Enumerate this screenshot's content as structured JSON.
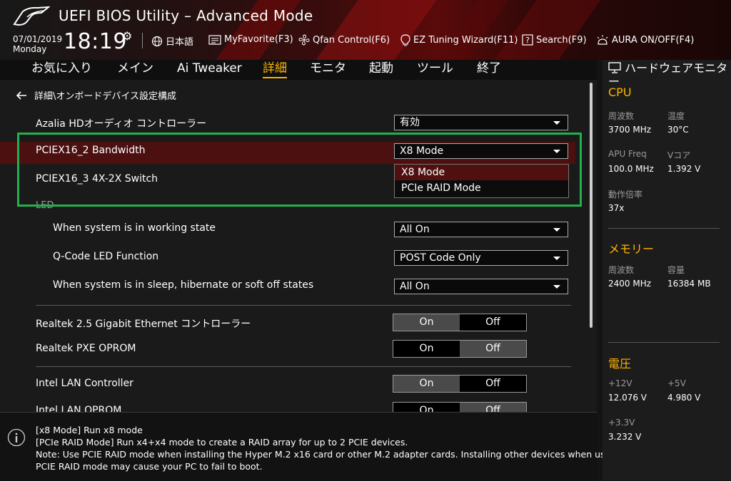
{
  "header": {
    "title": "UEFI BIOS Utility – Advanced Mode",
    "date": "07/01/2019",
    "day": "Monday",
    "time": "18:19",
    "items": [
      {
        "label": "日本語",
        "icon": "globe-icon"
      },
      {
        "label": "MyFavorite(F3)",
        "icon": "favorite-icon"
      },
      {
        "label": "Qfan Control(F6)",
        "icon": "fan-icon"
      },
      {
        "label": "EZ Tuning Wizard(F11)",
        "icon": "lightbulb-icon"
      },
      {
        "label": "Search(F9)",
        "icon": "search-icon"
      },
      {
        "label": "AURA ON/OFF(F4)",
        "icon": "aura-icon"
      }
    ]
  },
  "nav": {
    "tabs": [
      "お気に入り",
      "メイン",
      "Ai Tweaker",
      "詳細",
      "モニタ",
      "起動",
      "ツール",
      "終了"
    ],
    "active": "詳細"
  },
  "breadcrumb": "詳細\\オンボードデバイス設定構成",
  "settings": {
    "azalia": {
      "label": "Azalia HDオーディオ コントローラー",
      "value": "有効"
    },
    "pciex16_2": {
      "label": "PCIEX16_2 Bandwidth",
      "value": "X8 Mode",
      "options": [
        "X8 Mode",
        "PCIe RAID Mode"
      ]
    },
    "pciex16_3": {
      "label": "PCIEX16_3 4X-2X Switch"
    },
    "led_group": "LED",
    "led_working": {
      "label": "When system is in working state",
      "value": "All On"
    },
    "qcode": {
      "label": "Q-Code LED Function",
      "value": "POST Code Only"
    },
    "led_sleep": {
      "label": "When system is in sleep, hibernate or soft off states",
      "value": "All On"
    },
    "realtek_eth": {
      "label": "Realtek 2.5 Gigabit Ethernet コントローラー",
      "on": "On",
      "off": "Off",
      "state": "On"
    },
    "realtek_pxe": {
      "label": "Realtek PXE OPROM",
      "on": "On",
      "off": "Off",
      "state": "Off"
    },
    "intel_lan": {
      "label": "Intel LAN Controller",
      "on": "On",
      "off": "Off",
      "state": "On"
    },
    "intel_lan_oprom": {
      "label": "Intel LAN OPROM",
      "on": "On",
      "off": "Off",
      "state": "Off"
    }
  },
  "help": {
    "lines": [
      "[x8 Mode] Run x8 mode",
      "[PCIe RAID Mode] Run x4+x4 mode to create a RAID array for up to 2 PCIE devices.",
      "Note: Use PCIE RAID mode when installing the Hyper M.2 x16 card or other M.2 adapter cards. Installing other devices when using",
      "PCIE RAID mode may cause your PC to fail to boot."
    ]
  },
  "hw": {
    "title": "ハードウェアモニター",
    "cpu": {
      "title": "CPU",
      "freq_label": "周波数",
      "freq": "3700 MHz",
      "temp_label": "温度",
      "temp": "30°C",
      "apu_label": "APU Freq",
      "apu": "100.0 MHz",
      "vcore_label": "Vコア",
      "vcore": "1.392 V",
      "ratio_label": "動作倍率",
      "ratio": "37x"
    },
    "memory": {
      "title": "メモリー",
      "freq_label": "周波数",
      "freq": "2400 MHz",
      "cap_label": "容量",
      "cap": "16384 MB"
    },
    "voltage": {
      "title": "電圧",
      "v12_label": "+12V",
      "v12": "12.076 V",
      "v5_label": "+5V",
      "v5": "4.980 V",
      "v33_label": "+3.3V",
      "v33": "3.232 V"
    }
  }
}
